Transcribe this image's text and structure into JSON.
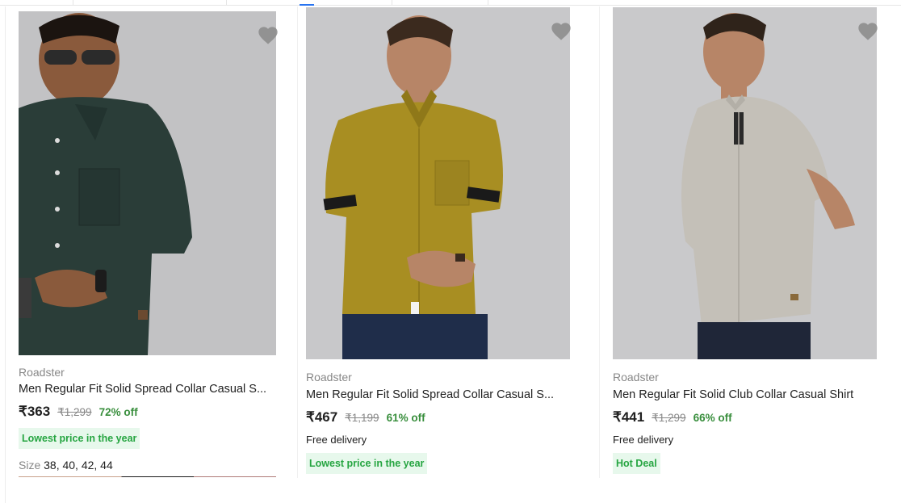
{
  "colors": {
    "accent": "#2874f0",
    "discount": "#388e3c",
    "badge_bg": "#e7f8ec",
    "badge_text": "#26a541",
    "muted": "#878787"
  },
  "products": [
    {
      "brand": "Roadster",
      "title": "Men Regular Fit Solid Spread Collar Casual S...",
      "price": "₹363",
      "mrp": "₹1,299",
      "discount": "72% off",
      "badge": "Lowest price in the year",
      "size_label": "Size",
      "sizes": "38, 40, 42, 44",
      "wishlist_icon": "heart-icon",
      "shirt_color": "#2a3d38"
    },
    {
      "brand": "Roadster",
      "title": "Men Regular Fit Solid Spread Collar Casual S...",
      "price": "₹467",
      "mrp": "₹1,199",
      "discount": "61% off",
      "delivery": "Free delivery",
      "badge": "Lowest price in the year",
      "wishlist_icon": "heart-icon",
      "shirt_color": "#a88e22"
    },
    {
      "brand": "Roadster",
      "title": "Men Regular Fit Solid Club Collar Casual Shirt",
      "price": "₹441",
      "mrp": "₹1,299",
      "discount": "66% off",
      "delivery": "Free delivery",
      "badge": "Hot Deal",
      "wishlist_icon": "heart-icon",
      "shirt_color": "#c4c0b8"
    }
  ]
}
